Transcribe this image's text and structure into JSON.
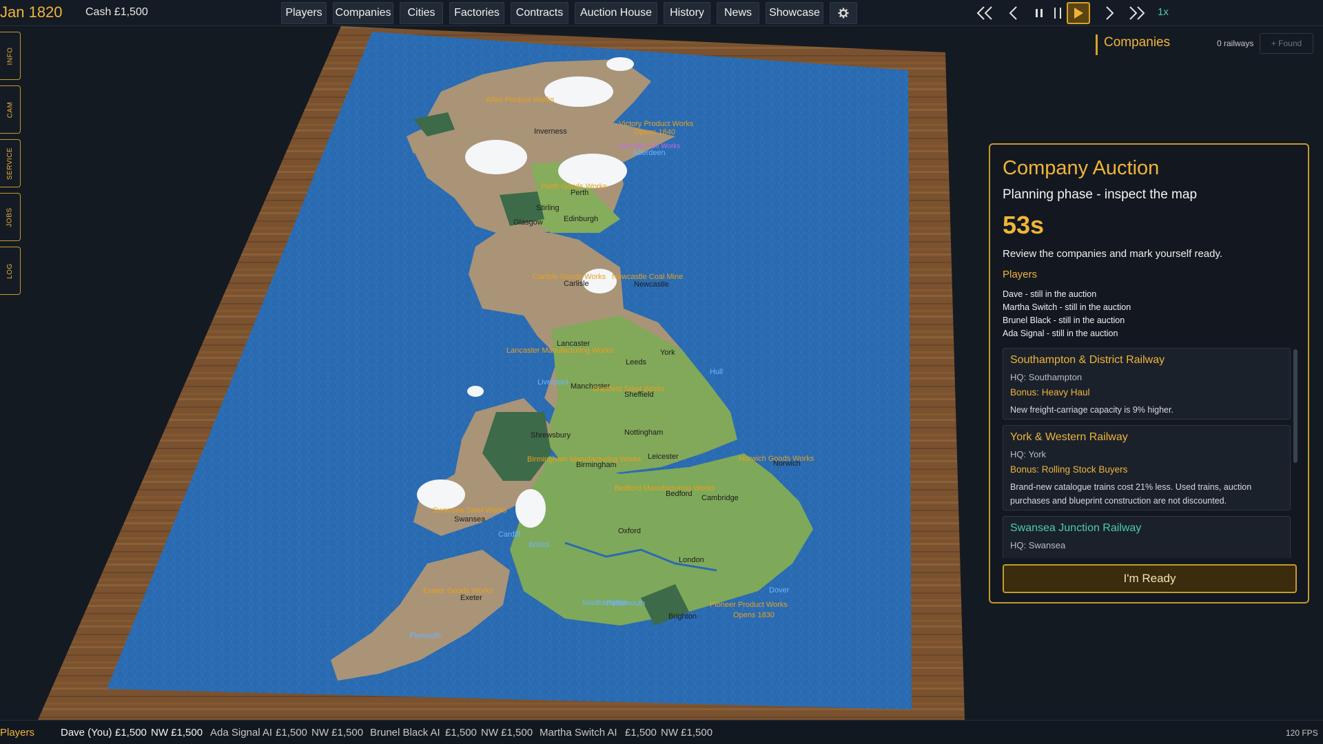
{
  "header": {
    "date": "Jan 1820",
    "cash": "Cash £1,500",
    "nav": [
      "Players",
      "Companies",
      "Cities",
      "Factories",
      "Contracts",
      "Auction House",
      "History",
      "News",
      "Showcase"
    ],
    "settings_icon": "gear-icon",
    "speed": "1x"
  },
  "sidebar": {
    "tabs": [
      "INFO",
      "CAM",
      "SERVICE",
      "JOBS",
      "LOG"
    ]
  },
  "companies_panel": {
    "title": "Companies",
    "count": "0 railways",
    "found_label": "+ Found"
  },
  "auction": {
    "title": "Company Auction",
    "phase": "Planning phase - inspect the map",
    "timer": "53s",
    "instruction": "Review the companies and mark yourself ready.",
    "players_label": "Players",
    "players": [
      "Dave - still in the auction",
      "Martha Switch - still in the auction",
      "Brunel Black - still in the auction",
      "Ada Signal - still in the auction"
    ],
    "companies": [
      {
        "name": "Southampton & District Railway",
        "hq": "HQ: Southampton",
        "bonus": "Bonus: Heavy Haul",
        "desc": "New freight-carriage capacity is 9% higher.",
        "color": "#f0b43a"
      },
      {
        "name": "York & Western Railway",
        "hq": "HQ: York",
        "bonus": "Bonus: Rolling Stock Buyers",
        "desc": "Brand-new catalogue trains cost 21% less. Used trains, auction purchases and blueprint construction are not discounted.",
        "color": "#f0b43a"
      },
      {
        "name": "Swansea Junction Railway",
        "hq": "HQ: Swansea",
        "bonus": "",
        "desc": "",
        "color": "#4ecca3"
      }
    ],
    "ready_label": "I'm Ready"
  },
  "bottom": {
    "label": "Players",
    "players": [
      {
        "name": "Dave (You)",
        "cash": "£1,500",
        "nw": "NW £1,500"
      },
      {
        "name": "Ada Signal AI",
        "cash": "£1,500",
        "nw": "NW £1,500"
      },
      {
        "name": "Brunel Black AI",
        "cash": "£1,500",
        "nw": "NW £1,500"
      },
      {
        "name": "Martha Switch AI",
        "cash": "£1,500",
        "nw": "NW £1,500"
      }
    ],
    "fps": "120 FPS"
  },
  "map": {
    "cities": [
      "Inverness",
      "Aberdeen",
      "Perth",
      "Stirling",
      "Glasgow",
      "Edinburgh",
      "Carlisle",
      "Newcastle",
      "Lancaster",
      "York",
      "Leeds",
      "Hull",
      "Liverpool",
      "Manchester",
      "Sheffield",
      "Nottingham",
      "Leicester",
      "Shrewsbury",
      "Birmingham",
      "Norwich",
      "Bedford",
      "Cambridge",
      "Swansea",
      "Cardiff",
      "Bristol",
      "Oxford",
      "London",
      "Exeter",
      "Southampton",
      "Portsmouth",
      "Brighton",
      "Dover",
      "Plymouth"
    ],
    "works": [
      "Atlas Product Works",
      "Victory Product Works",
      "Opens 1840",
      "Aberdeen Oil Works",
      "Perth Goods Works",
      "Carlisle Goods Works",
      "Newcastle Coal Mine",
      "Lancaster Manufacturing Works",
      "Sheffield Steel Works",
      "Birmingham Manufacturing Works",
      "Norwich Goods Works",
      "Bedford Manufacturing Works",
      "Swansea Steel Works",
      "Exeter Goods Works",
      "Pioneer Product Works",
      "Opens 1830"
    ]
  }
}
